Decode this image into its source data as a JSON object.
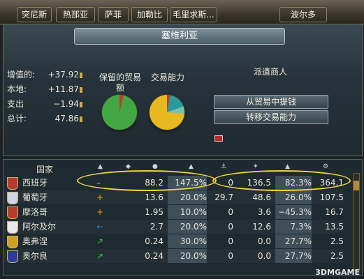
{
  "tabs": [
    "突尼斯",
    "热那亚",
    "萨菲",
    "加勒比",
    "毛里求斯...",
    "波尔多"
  ],
  "region_title": "塞维利亚",
  "stats": [
    {
      "label": "增值的:",
      "value": "+37.92"
    },
    {
      "label": "本地:",
      "value": "+11.87"
    },
    {
      "label": "支出",
      "value": "−1.94"
    },
    {
      "label": "总计:",
      "value": "47.86"
    }
  ],
  "pie_labels": {
    "retained": "保留的贸易额",
    "power": "交易能力"
  },
  "merchant": {
    "header": "派遣商人",
    "collect_label": "从贸易中提钱",
    "transfer_label": "转移交易能力"
  },
  "table": {
    "country_header": "国家",
    "rows": [
      {
        "name": "西班牙",
        "action": "–",
        "c1": "88.2",
        "c2": "147.5%",
        "c3": "0",
        "c4": "136.5",
        "c5": "82.3%",
        "c6": "364.1",
        "flag": "#b83a2e"
      },
      {
        "name": "葡萄牙",
        "action": "+",
        "c1": "13.6",
        "c2": "20.0%",
        "c3": "29.7",
        "c4": "48.6",
        "c5": "26.0%",
        "c6": "107.5",
        "flag": "#cfd4e8"
      },
      {
        "name": "摩洛哥",
        "action": "+",
        "c1": "1.95",
        "c2": "10.0%",
        "c3": "0",
        "c4": "3.6",
        "c5": "−45.3%",
        "c6": "16.7",
        "flag": "#b83a2e"
      },
      {
        "name": "阿尔及尔",
        "action": "←",
        "c1": "2.7",
        "c2": "20.0%",
        "c3": "0",
        "c4": "12.6",
        "c5": "7.3%",
        "c6": "13.5",
        "flag": "#e8e8f0"
      },
      {
        "name": "奥弗涅",
        "action": "↗",
        "c1": "0.24",
        "c2": "30.0%",
        "c3": "0",
        "c4": "0.0",
        "c5": "27.7%",
        "c6": "2.5",
        "flag": "#d0a020"
      },
      {
        "name": "奥尔良",
        "action": "↗",
        "c1": "0.24",
        "c2": "20.0%",
        "c3": "0",
        "c4": "0.0",
        "c5": "27.7%",
        "c6": "2.5",
        "flag": "#2c3c9c"
      }
    ]
  },
  "watermark": "3DMGAME"
}
